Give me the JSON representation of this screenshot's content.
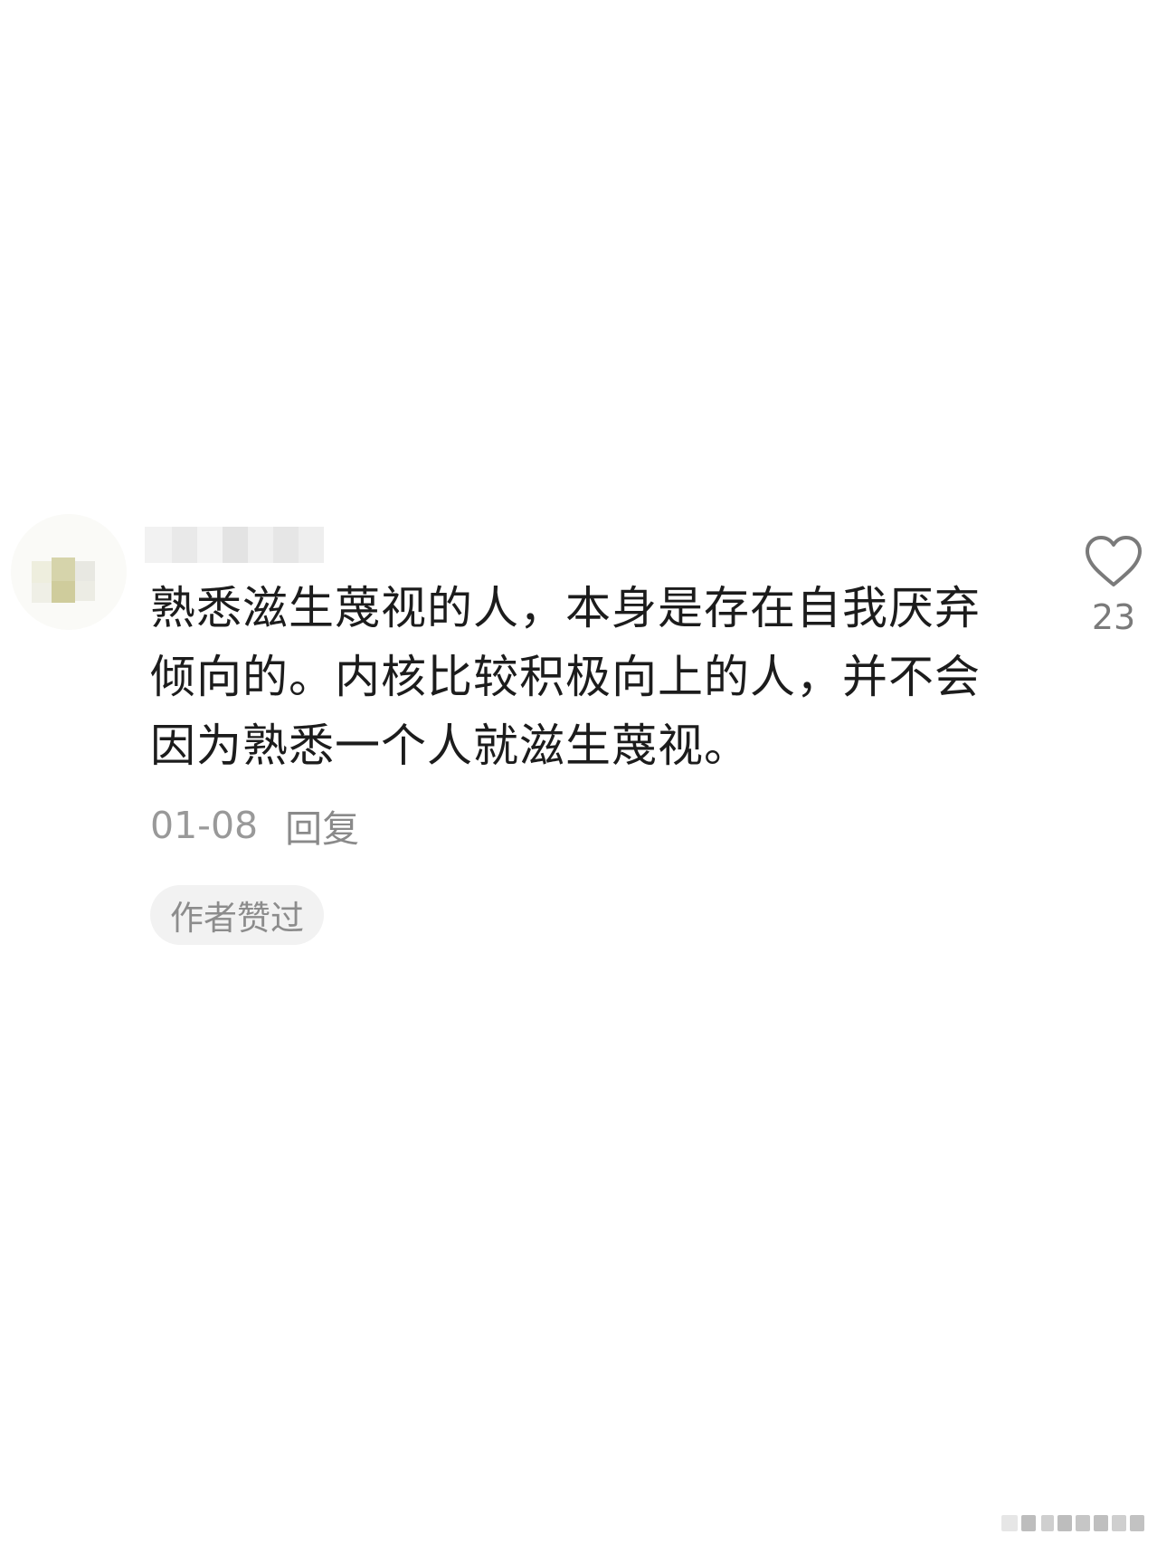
{
  "comment": {
    "text": "熟悉滋生蔑视的人，本身是存在自我厌弃倾向的。内核比较积极向上的人，并不会因为熟悉一个人就滋生蔑视。",
    "date": "01-08",
    "reply_label": "回复",
    "badge_label": "作者赞过",
    "like_count": "23",
    "like_icon": "heart-outline-icon"
  },
  "colors": {
    "text": "#1c1c1c",
    "meta": "#999999",
    "badge_bg": "#f2f2f2",
    "like_icon": "#7a7a7a"
  }
}
